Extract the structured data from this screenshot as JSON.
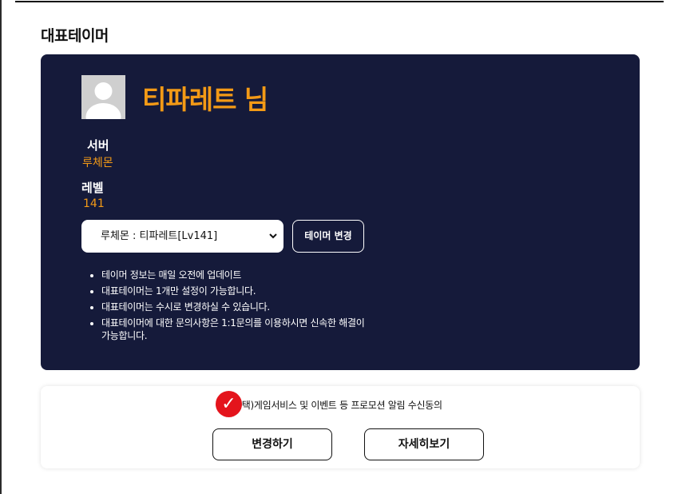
{
  "section": {
    "title": "대표테이머"
  },
  "profile": {
    "name": "티파레트 님",
    "server_label": "서버",
    "server_value": "루체몬",
    "level_label": "레벨",
    "level_value": "141"
  },
  "tamer_select": {
    "selected": "루체몬 : 티파레트[Lv141]",
    "button_label": "테이머 변경"
  },
  "notes": [
    "테이머 정보는 매일 오전에 업데이트",
    "대표테이머는 1개만 설정이 가능합니다.",
    "대표테이머는 수시로 변경하실 수 있습니다.",
    "대표테이머에 대한 문의사항은 1:1문의를 이용하시면 신속한 해결이 가능합니다."
  ],
  "consent": {
    "checked": true,
    "text": "선택)게임서비스 및 이벤트 등 프로모션 알림 수신동의",
    "check_mark": "✓"
  },
  "actions": {
    "change_label": "변경하기",
    "detail_label": "자세히보기"
  },
  "colors": {
    "card_bg": "#151a3a",
    "accent": "#f39a16",
    "check": "#e4141c"
  }
}
